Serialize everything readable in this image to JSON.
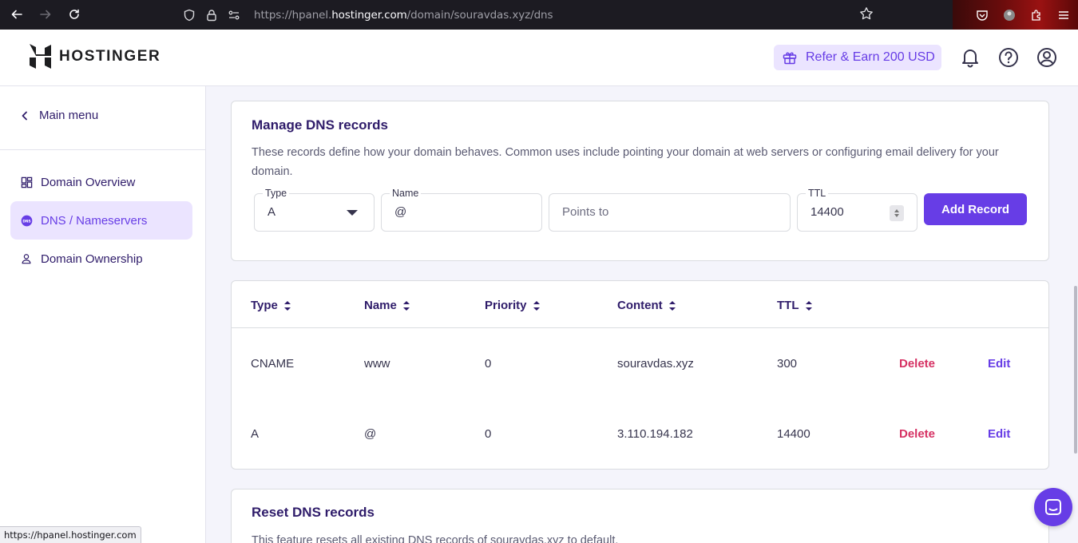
{
  "browser": {
    "url_prefix": "https://hpanel.",
    "url_host": "hostinger.com",
    "url_path": "/domain/souravdas.xyz/dns",
    "status_url": "https://hpanel.hostinger.com"
  },
  "header": {
    "logo_text": "HOSTINGER",
    "refer_label": "Refer & Earn 200 USD"
  },
  "sidebar": {
    "main_menu": "Main menu",
    "items": [
      {
        "label": "Domain Overview",
        "icon": "grid-icon",
        "active": false
      },
      {
        "label": "DNS / Nameservers",
        "icon": "dns-icon",
        "active": true
      },
      {
        "label": "Domain Ownership",
        "icon": "person-icon",
        "active": false
      }
    ]
  },
  "manage": {
    "title": "Manage DNS records",
    "description": "These records define how your domain behaves. Common uses include pointing your domain at web servers or configuring email delivery for your domain.",
    "type_label": "Type",
    "type_value": "A",
    "name_label": "Name",
    "name_value": "@",
    "points_placeholder": "Points to",
    "ttl_label": "TTL",
    "ttl_value": "14400",
    "add_button": "Add Record"
  },
  "table": {
    "headers": [
      "Type",
      "Name",
      "Priority",
      "Content",
      "TTL"
    ],
    "rows": [
      {
        "type": "CNAME",
        "name": "www",
        "priority": "0",
        "content": "souravdas.xyz",
        "ttl": "300"
      },
      {
        "type": "A",
        "name": "@",
        "priority": "0",
        "content": "3.110.194.182",
        "ttl": "14400"
      }
    ],
    "delete_label": "Delete",
    "edit_label": "Edit"
  },
  "reset": {
    "title": "Reset DNS records",
    "description": "This feature resets all existing DNS records of souravdas.xyz to default."
  },
  "colors": {
    "accent": "#673de6",
    "danger": "#d63163",
    "active_bg": "#ebe4ff"
  }
}
